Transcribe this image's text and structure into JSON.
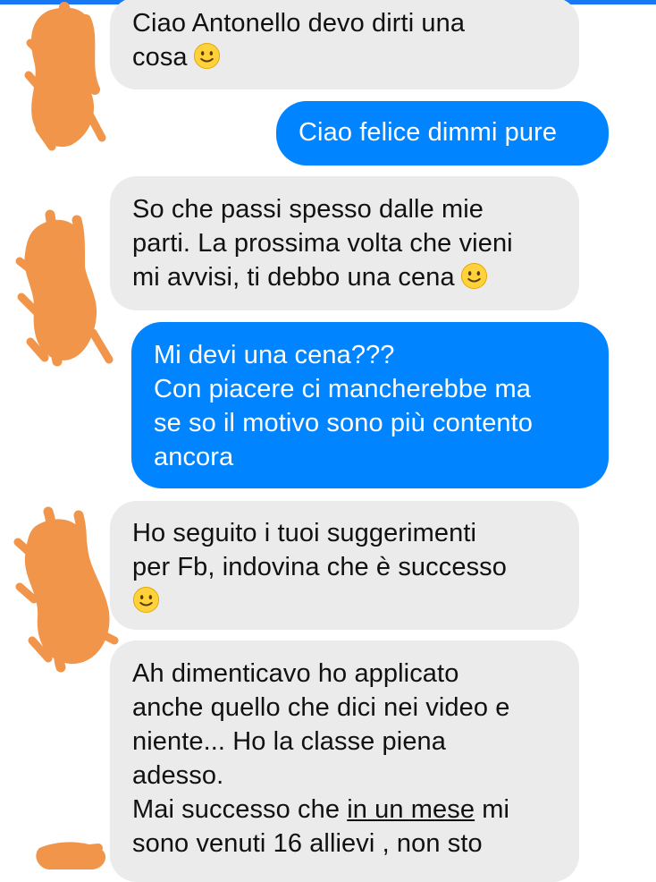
{
  "conversation": {
    "messages": [
      {
        "sender": "contact",
        "lines": [
          "Ciao Antonello devo dirti una",
          "cosa"
        ],
        "trailing_emoji": "slightly-smiling-face-icon"
      },
      {
        "sender": "me",
        "lines": [
          "Ciao felice dimmi pure"
        ]
      },
      {
        "sender": "contact",
        "lines": [
          "So che passi spesso dalle mie",
          "parti. La prossima volta che vieni",
          "mi avvisi, ti debbo una cena"
        ],
        "trailing_emoji": "slightly-smiling-face-icon"
      },
      {
        "sender": "me",
        "lines": [
          "Mi devi una cena???",
          "Con piacere ci mancherebbe ma",
          "se so il motivo sono più contento",
          "ancora"
        ]
      },
      {
        "sender": "contact",
        "lines": [
          "Ho seguito i tuoi suggerimenti",
          "per Fb, indovina che è successo"
        ],
        "trailing_emoji": "slightly-smiling-face-icon"
      },
      {
        "sender": "contact",
        "lines": [
          "Ah dimenticavo ho applicato",
          "anche quello che dici nei video e",
          "niente... Ho la classe piena",
          "adesso.",
          "Mai successo che ",
          "in un mese",
          " mi",
          "sono venuti 16 allievi , non sto"
        ]
      }
    ]
  },
  "colors": {
    "incoming_bubble": "#ebebeb",
    "outgoing_bubble": "#0084ff",
    "outgoing_text": "#ffffff",
    "scribble": "#f0954a",
    "top_accent": "#1877f2",
    "emoji_face": "#ffd23c"
  }
}
